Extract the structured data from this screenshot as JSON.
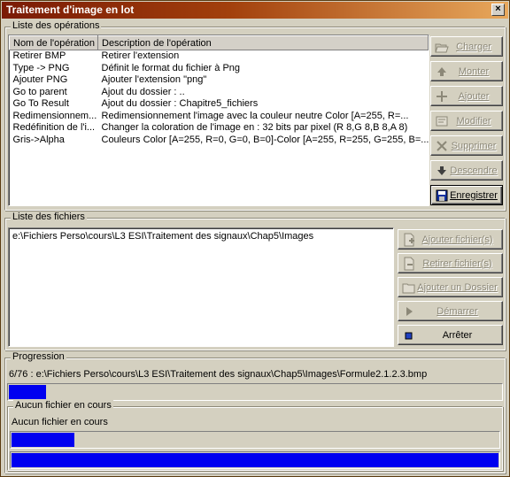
{
  "window": {
    "title": "Traitement d'image en lot",
    "close_glyph": "×"
  },
  "operations": {
    "legend": "Liste des opérations",
    "columns": [
      "Nom de l'opération",
      "Description de l'opération"
    ],
    "rows": [
      [
        "Retirer BMP",
        "Retirer l'extension"
      ],
      [
        "Type -> PNG",
        "Définit le format du fichier à Png"
      ],
      [
        "Ajouter PNG",
        "Ajouter l'extension \"png\""
      ],
      [
        "Go to parent",
        "Ajout du dossier : .."
      ],
      [
        "Go To Result",
        "Ajout du dossier : Chapitre5_fichiers"
      ],
      [
        "Redimensionnem...",
        "Redimensionnement l'image avec la couleur neutre Color [A=255, R=..."
      ],
      [
        "Redéfinition de l'i...",
        "Changer la coloration de l'image en : 32 bits par pixel (R 8,G 8,B 8,A 8)"
      ],
      [
        "Gris->Alpha",
        "Couleurs Color [A=255, R=0, G=0, B=0]-Color [A=255, R=255, G=255, B=..."
      ]
    ],
    "buttons": {
      "charger": "Charger",
      "monter": "Monter",
      "ajouter": "Ajouter",
      "modifier": "Modifier",
      "supprimer": "Supprimer",
      "descendre": "Descendre",
      "enregistrer": "Enregistrer"
    }
  },
  "files": {
    "legend": "Liste des fichiers",
    "items": [
      "e:\\Fichiers Perso\\cours\\L3 ESI\\Traitement des signaux\\Chap5\\Images"
    ],
    "buttons": {
      "ajouter_fichiers": "Ajouter fichier(s)",
      "retirer_fichiers": "Retirer fichier(s)",
      "ajouter_dossier": "Ajouter un Dossier",
      "demarrer": "Démarrer",
      "arreter": "Arrêter"
    }
  },
  "progress": {
    "legend": "Progression",
    "status": "6/76 : e:\\Fichiers Perso\\cours\\L3 ESI\\Traitement des signaux\\Chap5\\Images\\Formule2.1.2.3.bmp",
    "overall_fraction": 0.076,
    "current": {
      "legend": "Aucun fichier en cours",
      "status": "Aucun fichier en cours",
      "small_fraction": 0.13,
      "full_fraction": 1.0
    }
  },
  "colors": {
    "progress_fill": "#0000f0",
    "title_start": "#7a1a05",
    "title_end": "#e8a85c"
  }
}
